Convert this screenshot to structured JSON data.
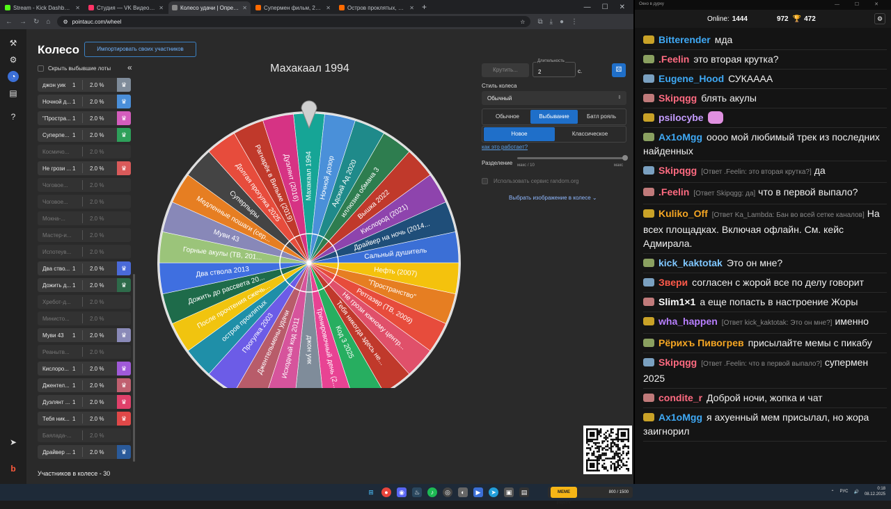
{
  "browser": {
    "tabs": [
      {
        "label": "Stream - Kick Dashboard",
        "color": "#53fc18"
      },
      {
        "label": "Студия — VK Видео Live",
        "color": "#ff3366"
      },
      {
        "label": "Колесо удачи | Определите п",
        "color": "#888888"
      },
      {
        "label": "Супермен фильм, 2025, дата в",
        "color": "#ff6a00"
      },
      {
        "label": "Остров проклятых, 2009 — оп",
        "color": "#ff6a00"
      }
    ],
    "url": "pointauc.com/wheel"
  },
  "page": {
    "title": "Колесо",
    "import_label": "Импортировать своих участников",
    "hide_label": "Скрыть выбывшие лоты",
    "participants_label": "Участников в колесе - 30",
    "winner": "Махакаал 1994",
    "spin_label": "Крутить...",
    "duration_label": "Длительность",
    "duration_value": "2",
    "duration_unit": "с.",
    "style_label": "Стиль колеса",
    "style_value": "Обычный",
    "modes": [
      "Обычное",
      "Выбывание",
      "Батл рояль"
    ],
    "submodes": [
      "Новое",
      "Классическое"
    ],
    "how_label": "как это работает?",
    "split_label": "Разделение",
    "split_min": "макс / 10",
    "split_max": "макс",
    "random_org_label": "Использовать сервис random.org",
    "pick_image_label": "Выбрать изображение в колесе"
  },
  "lots": [
    {
      "name": "джон уик",
      "count": "1",
      "percent": "2.0 %",
      "color": "#7f8c9a",
      "active": true
    },
    {
      "name": "Ночной д...",
      "count": "1",
      "percent": "2.0 %",
      "color": "#4a8fd9",
      "active": true
    },
    {
      "name": "\"Простра...",
      "count": "1",
      "percent": "2.0 %",
      "color": "#d45dbd",
      "active": true
    },
    {
      "name": "Суперпе...",
      "count": "1",
      "percent": "2.0 %",
      "color": "#2ea05a",
      "active": true
    },
    {
      "name": "Космичо...",
      "count": "",
      "percent": "2.0 %",
      "color": "",
      "active": false
    },
    {
      "name": "Не грози ...",
      "count": "1",
      "percent": "2.0 %",
      "color": "#d95a5a",
      "active": true
    },
    {
      "name": "Чоговое...",
      "count": "",
      "percent": "2.0 %",
      "color": "",
      "active": false
    },
    {
      "name": "Чоговое...",
      "count": "",
      "percent": "2.0 %",
      "color": "",
      "active": false
    },
    {
      "name": "Мокна-...",
      "count": "",
      "percent": "2.0 %",
      "color": "",
      "active": false
    },
    {
      "name": "Мастер-и...",
      "count": "",
      "percent": "2.0 %",
      "color": "",
      "active": false
    },
    {
      "name": "Испотеув...",
      "count": "",
      "percent": "2.0 %",
      "color": "",
      "active": false
    },
    {
      "name": "Два ство...",
      "count": "1",
      "percent": "2.0 %",
      "color": "#4a6ad8",
      "active": true
    },
    {
      "name": "Дожить д...",
      "count": "1",
      "percent": "2.0 %",
      "color": "#2e6b4a",
      "active": true
    },
    {
      "name": "Хребот-д...",
      "count": "",
      "percent": "2.0 %",
      "color": "",
      "active": false
    },
    {
      "name": "Министо...",
      "count": "",
      "percent": "2.0 %",
      "color": "",
      "active": false
    },
    {
      "name": "Муви 43",
      "count": "1",
      "percent": "2.0 %",
      "color": "#8a8ab8",
      "active": true
    },
    {
      "name": "Реанытв...",
      "count": "",
      "percent": "2.0 %",
      "color": "",
      "active": false
    },
    {
      "name": "Кислоро...",
      "count": "1",
      "percent": "2.0 %",
      "color": "#a05ad8",
      "active": true
    },
    {
      "name": "Джентел...",
      "count": "1",
      "percent": "2.0 %",
      "color": "#c06070",
      "active": true
    },
    {
      "name": "Дуэлянт ...",
      "count": "1",
      "percent": "2.0 %",
      "color": "#e0406a",
      "active": true
    },
    {
      "name": "Тебя ник...",
      "count": "1",
      "percent": "2.0 %",
      "color": "#e04848",
      "active": true
    },
    {
      "name": "Баялада-...",
      "count": "",
      "percent": "2.0 %",
      "color": "",
      "active": false
    },
    {
      "name": "Драйвер ...",
      "count": "1",
      "percent": "2.0 %",
      "color": "#2a5a9a",
      "active": true
    }
  ],
  "wheel": {
    "segments": [
      {
        "label": "Махакаал 1994",
        "color": "#16a596"
      },
      {
        "label": "Ночной дозор",
        "color": "#4a90d9"
      },
      {
        "label": "Адский Ад 2020",
        "color": "#1f8a8a"
      },
      {
        "label": "иллюзия обмана 3",
        "color": "#2e7d4f"
      },
      {
        "label": "Вышка 2022",
        "color": "#c0392b"
      },
      {
        "label": "Кислород (2021)",
        "color": "#8e44ad"
      },
      {
        "label": "Драйвер на ночь (2014...",
        "color": "#1f4e79"
      },
      {
        "label": "Сальный душитель",
        "color": "#3b6fd6"
      },
      {
        "label": "Нефть (2007)",
        "color": "#f4c20d"
      },
      {
        "label": "\"Пространство\"",
        "color": "#e67e22"
      },
      {
        "label": "Ретгаэвр (ТВ, 2009)",
        "color": "#e74c3c"
      },
      {
        "label": "Не грози южному центр...",
        "color": "#e0506a"
      },
      {
        "label": "Тебя никогда здесь не...",
        "color": "#c0392b"
      },
      {
        "label": "Код 3 2025",
        "color": "#27ae60"
      },
      {
        "label": "Тренировочный день (2...",
        "color": "#e84393"
      },
      {
        "label": "джон уик",
        "color": "#7f8c9a"
      },
      {
        "label": "Исходный код 2011",
        "color": "#d6549c"
      },
      {
        "label": "Джентельмены удачи",
        "color": "#b85c6a"
      },
      {
        "label": "Прогулка 2003",
        "color": "#6c5ce7"
      },
      {
        "label": "остров проклятых",
        "color": "#1f8fa8"
      },
      {
        "label": "После прочтения сжечь...",
        "color": "#f1c40f"
      },
      {
        "label": "Дожить до рассвета 20...",
        "color": "#1e6b4a"
      },
      {
        "label": "Два ствола 2013",
        "color": "#3f6fe0"
      },
      {
        "label": "Горные акулы (ТВ, 201...",
        "color": "#9bc47a"
      },
      {
        "label": "Муви 43",
        "color": "#8888b8"
      },
      {
        "label": "Медленные пошаги (сер...",
        "color": "#e67e22"
      },
      {
        "label": "Суперпыры",
        "color": "#444444"
      },
      {
        "label": "Долгая прогулка 2025",
        "color": "#e74c3c"
      },
      {
        "label": "Рагнарёк в Вильме (2019)",
        "color": "#c0392b"
      },
      {
        "label": "Дуэлянт (2016)",
        "color": "#d63384"
      }
    ]
  },
  "chat": {
    "window_title": "Окно в дурку",
    "online_label": "Online:",
    "online_value": "1444",
    "stat1": "972",
    "stat2": "472",
    "messages": [
      {
        "user": "Bitterender",
        "color": "#3fa9f5",
        "reply": "",
        "text": "мда"
      },
      {
        "user": ".Feelin",
        "color": "#ff6b81",
        "reply": "",
        "text": "это вторая крутка?"
      },
      {
        "user": "Eugene_Hood",
        "color": "#3fa9f5",
        "reply": "",
        "text": "СУКАААА"
      },
      {
        "user": "Skipqgg",
        "color": "#ff6b81",
        "reply": "",
        "text": "блять акулы"
      },
      {
        "user": "psilocybe",
        "color": "#c59cff",
        "reply": "",
        "text": ""
      },
      {
        "user": "Ax1oMgg",
        "color": "#3fa9f5",
        "reply": "",
        "text": "оооо мой любимый трек из последних найденных"
      },
      {
        "user": "Skipqgg",
        "color": "#ff6b81",
        "reply": "[Ответ .Feelin: это вторая крутка?]",
        "text": "да"
      },
      {
        "user": ".Feelin",
        "color": "#ff6b81",
        "reply": "[Ответ Skipqgg: да]",
        "text": "что в первой выпало?"
      },
      {
        "user": "Kuliko_Off",
        "color": "#f5a623",
        "reply": "[Ответ Ka_Lambda: Бан во всей сетке каналов]",
        "text": "На всех площадках. Включая офлайн. См. кейс Адмирала."
      },
      {
        "user": "kick_kaktotak",
        "color": "#7fc7ff",
        "reply": "",
        "text": "Это он мне?"
      },
      {
        "user": "Звери",
        "color": "#ff5a4a",
        "reply": "",
        "text": "согласен с жорой все по делу говорит"
      },
      {
        "user": "Slim1×1",
        "color": "#ffffff",
        "reply": "",
        "text": "а еще попасть в настроение Жоры"
      },
      {
        "user": "wha_happen",
        "color": "#b87fff",
        "reply": "[Ответ kick_kaktotak: Это он мне?]",
        "text": "именно"
      },
      {
        "user": "Рёрихъ Пивогрев",
        "color": "#f5a623",
        "reply": "",
        "text": "присылайте мемы с пикабу"
      },
      {
        "user": "Skipqgg",
        "color": "#ff6b81",
        "reply": "[Ответ .Feelin: что в первой выпало?]",
        "text": "супермен 2025"
      },
      {
        "user": "condite_r",
        "color": "#ff6b81",
        "reply": "",
        "text": "Доброй ночи, жопка и чат"
      },
      {
        "user": "Ax1oMgg",
        "color": "#3fa9f5",
        "reply": "",
        "text": "я ахуенный мем присылал, но жора заигнорил"
      }
    ]
  },
  "taskbar": {
    "lang": "РУС",
    "time": "0:18",
    "date": "08.12.2025",
    "meme_label": "MEME PARTY",
    "meme_count": "800 / 1500"
  }
}
